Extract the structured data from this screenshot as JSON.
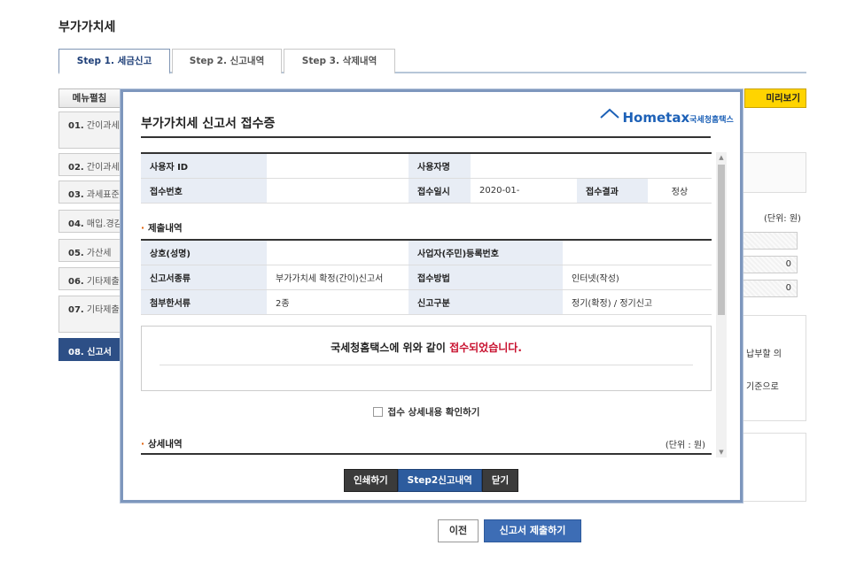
{
  "page": {
    "title": "부가가치세"
  },
  "tabs": [
    {
      "label": "Step 1. 세금신고"
    },
    {
      "label": "Step 2. 신고내역"
    },
    {
      "label": "Step 3. 삭제내역"
    }
  ],
  "menu_close": "메뉴펼침",
  "sidebar": [
    {
      "num": "01.",
      "label": "간이과세 입력"
    },
    {
      "num": "02.",
      "label": "간이과세"
    },
    {
      "num": "03.",
      "label": "과세표준"
    },
    {
      "num": "04.",
      "label": "매입.경감"
    },
    {
      "num": "05.",
      "label": "가산세"
    },
    {
      "num": "06.",
      "label": "기타제출"
    },
    {
      "num": "07.",
      "label": "기타제출 제외)"
    },
    {
      "num": "08.",
      "label": "신고서"
    }
  ],
  "preview_button": "미리보기",
  "background": {
    "unit": "(단위: 원)",
    "field_values": [
      "",
      "0",
      "0"
    ],
    "text1": "납부할 의",
    "text2": "기준으로"
  },
  "bottom": {
    "prev": "이전",
    "submit": "신고서 제출하기"
  },
  "modal": {
    "title": "부가가치세 신고서 접수증",
    "logo_main": "Hometax",
    "logo_sub": "국세청홈택스",
    "receipt_rows": [
      {
        "h1": "사용자 ID",
        "v1": "",
        "h2": "사용자명",
        "v2": "",
        "h3": "",
        "v3": ""
      },
      {
        "h1": "접수번호",
        "v1": "",
        "h2": "접수일시",
        "v2": "2020-01-",
        "h3": "접수결과",
        "v3": "정상"
      }
    ],
    "section_submit": "제출내역",
    "submit_rows": [
      {
        "h1": "상호(성명)",
        "v1": "",
        "h2": "사업자(주민)등록번호",
        "v2": ""
      },
      {
        "h1": "신고서종류",
        "v1": "부가가치세 확정(간이)신고서",
        "h2": "접수방법",
        "v2": "인터넷(작성)"
      },
      {
        "h1": "첨부한서류",
        "v1": "2종",
        "h2": "신고구분",
        "v2": "정기(확정) / 정기신고"
      }
    ],
    "notice_prefix": "국세청홈택스에 위와 같이 ",
    "notice_highlight": "접수되었습니다.",
    "check_label": "접수 상세내용 확인하기",
    "section_detail": "상세내역",
    "detail_unit": "(단위 : 원)",
    "buttons": {
      "print": "인쇄하기",
      "step2": "Step2신고내역",
      "close": "닫기"
    }
  }
}
